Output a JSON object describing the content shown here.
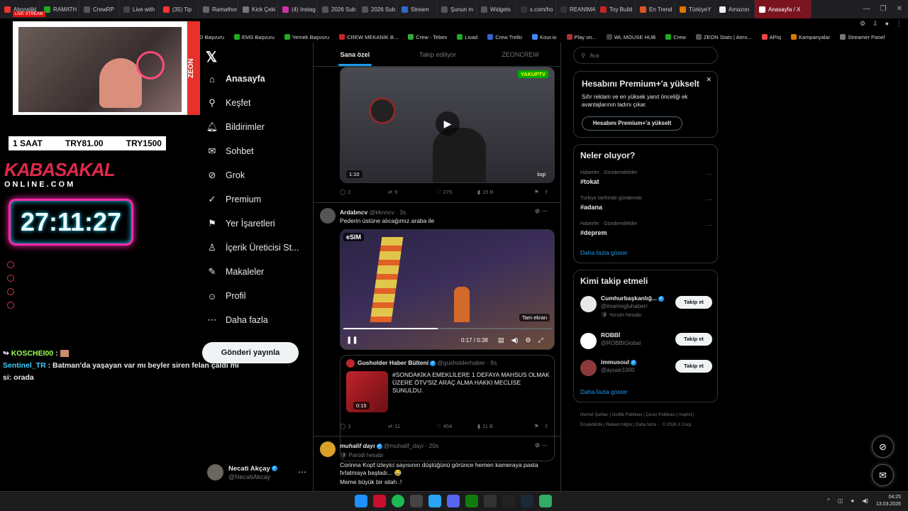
{
  "browser": {
    "tabs": [
      {
        "label": "Abonelikl",
        "color": "#e33"
      },
      {
        "label": "RAMATH",
        "color": "#2a2"
      },
      {
        "label": "CrewRP",
        "color": "#555"
      },
      {
        "label": "Live with",
        "color": "#444"
      },
      {
        "label": "(35) Tip",
        "color": "#f33"
      },
      {
        "label": "Ramathor",
        "color": "#666"
      },
      {
        "label": "Kick Çeki",
        "color": "#777"
      },
      {
        "label": "(4) Instag",
        "color": "#c3a"
      },
      {
        "label": "2026 Sub",
        "color": "#555"
      },
      {
        "label": "2026 Sub",
        "color": "#555"
      },
      {
        "label": "Stream",
        "color": "#36c"
      },
      {
        "label": "Şunun m",
        "color": "#555"
      },
      {
        "label": "Widgets",
        "color": "#555"
      },
      {
        "label": "x.com/ho",
        "color": "#333"
      },
      {
        "label": "REANIMA",
        "color": "#333"
      },
      {
        "label": "Toy Build",
        "color": "#c22"
      },
      {
        "label": "En Trend",
        "color": "#d52"
      },
      {
        "label": "TürkiyeY",
        "color": "#d70"
      },
      {
        "label": "Amazon",
        "color": "#eee"
      }
    ],
    "active_tab": "Anasayfa / X",
    "bookmarks": [
      "PD Başvuru",
      "EMS Başvuru",
      "Yemek Başvuru",
      "CREW MEKANİK B...",
      "Crew - Tebex",
      "Livad",
      "Crew Trello",
      "Kour.io",
      "Play on...",
      "WL MOUSE HUB",
      "Crew",
      "ZEON Stats | Aero...",
      "APIq",
      "Kampanyalar",
      "Streamer Panel"
    ]
  },
  "stream": {
    "live_label": "LIVE STREAM",
    "sponsor": "ZEON",
    "price_bar": [
      "1 SAAT",
      "TRY81.00",
      "TRY1500"
    ],
    "brand": "KABASAKAL",
    "brand_sub": "ONLINE.COM",
    "timer": "27:11:27",
    "chat": [
      {
        "user": "KOSCHEI00",
        "text": ""
      },
      {
        "user": "Sentinel_TR",
        "text": "Batman'da yaşayan var mı beyler siren felan çaldı mı si: orada"
      }
    ],
    "colors": {
      "user1": "#9cff57",
      "user2": "#3ecfff"
    }
  },
  "nav": {
    "items": [
      {
        "label": "Anasayfa",
        "icon": "home-icon",
        "glyph": "⌂"
      },
      {
        "label": "Keşfet",
        "icon": "search-icon",
        "glyph": "⚲"
      },
      {
        "label": "Bildirimler",
        "icon": "bell-icon",
        "glyph": "🔔︎"
      },
      {
        "label": "Sohbet",
        "icon": "mail-icon",
        "glyph": "✉"
      },
      {
        "label": "Grok",
        "icon": "grok-icon",
        "glyph": "⊘"
      },
      {
        "label": "Premium",
        "icon": "premium-icon",
        "glyph": "✓"
      },
      {
        "label": "Yer İşaretleri",
        "icon": "bookmark-icon",
        "glyph": "⚑"
      },
      {
        "label": "İçerik Üreticisi St...",
        "icon": "creator-icon",
        "glyph": "♙"
      },
      {
        "label": "Makaleler",
        "icon": "articles-icon",
        "glyph": "✎"
      },
      {
        "label": "Profil",
        "icon": "profile-icon",
        "glyph": "☺"
      },
      {
        "label": "Daha fazla",
        "icon": "more-icon",
        "glyph": "⋯"
      }
    ],
    "post_button": "Gönderi yayınla",
    "profile": {
      "name": "Necati Akçay",
      "handle": "@NecatiAkcay"
    }
  },
  "feed": {
    "tabs": [
      "Sana özel",
      "Takip ediliyor",
      "ZEONCREW"
    ],
    "post0": {
      "duration": "1:10",
      "replies": "2",
      "reposts": "9",
      "likes": "275",
      "views": "15 B",
      "watermark": "YAKUPTV",
      "watermark_small": "logi"
    },
    "post1": {
      "name": "Ardabncv",
      "handle": "@kknncv · 3s",
      "text": "Pederin üstüne alıcağımız araba ile",
      "time": "0:17 / 0:38",
      "fullscreen_label": "Tam ekran",
      "overlay": "eSIM",
      "quote": {
        "name": "Gusholder Haber Bülteni",
        "handle": "@gusholderhaber · 8s",
        "text": "#SONDAKİKA EMEKLİLERE 1 DEFAYA MAHSUS OLMAK ÜZERE ÖTV'SİZ ARAÇ ALMA HAKKI MECLİSE SUNULDU.",
        "duration": "0:15"
      },
      "replies": "1",
      "reposts": "11",
      "likes": "454",
      "views": "11 B"
    },
    "post2": {
      "name": "muhalif dayı",
      "handle": "@muhalif_dayi · 20s",
      "label": "Parodi hesabı",
      "text": "Corinna Kopf izleyici sayısının düştüğünü görünce hemen kameraya pasta fırlatmaya başladı... 😂",
      "text2": "Meme büyük bir silah .!"
    }
  },
  "right": {
    "search_placeholder": "Ara",
    "premium": {
      "title": "Hesabını Premium+'a yükselt",
      "desc": "Sıfır reklam ve en yüksek yanıt önceliği ek avantajlarının tadını çıkar.",
      "button": "Hesabını Premium+'a yükselt"
    },
    "trends_title": "Neler oluyor?",
    "trends": [
      {
        "cat": "Haberler · Gündemdekiler",
        "tag": "#tokat"
      },
      {
        "cat": "Türkiye tarihinde gündemde",
        "tag": "#adana"
      },
      {
        "cat": "Haberler · Gündemdekiler",
        "tag": "#deprem"
      }
    ],
    "show_more": "Daha fazla göster",
    "follow_title": "Kimi takip etmeli",
    "follow": [
      {
        "name": "Cumhurbaşkanlığ...",
        "handle": "@imamogluhaberr",
        "extra": "Yorum hesabı",
        "button": "Takip et"
      },
      {
        "name": "ROBBİ",
        "handle": "@ROBBIGlobal",
        "extra": "",
        "button": "Takip et"
      },
      {
        "name": "immusoul",
        "handle": "@ayuan1000",
        "extra": "",
        "button": "Takip et"
      }
    ],
    "footer": "Hizmet Şartları | Gizlilik Politikası | Çerez Politikası | Imprint | Erişilebilirlik | Reklam bilgisi | Daha fazla ··· © 2026 X Corp."
  },
  "taskbar": {
    "time": "04:25",
    "date": "13.03.2026"
  },
  "colors": {
    "accent": "#1d9bf0",
    "tab_active": "#7a1520",
    "timer_glow": "#ff2aa8",
    "brand_red": "#e0294a"
  }
}
